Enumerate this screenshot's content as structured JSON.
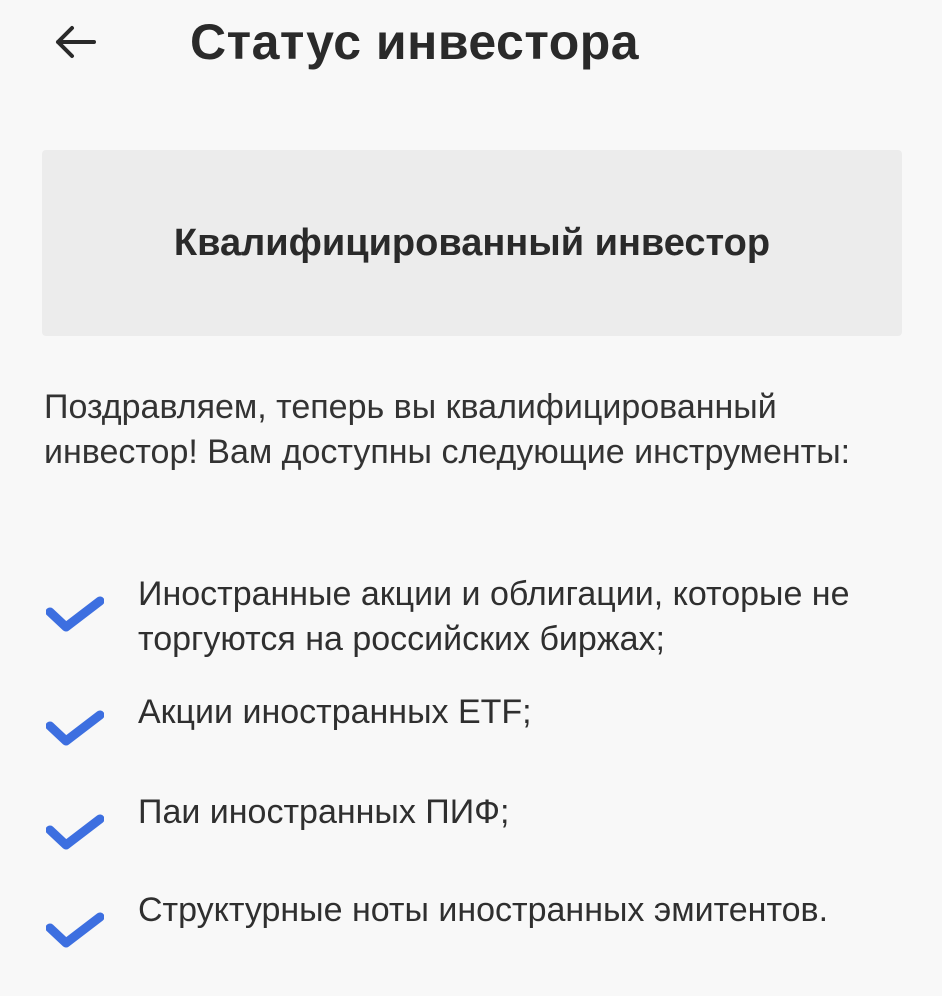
{
  "header": {
    "back_icon": "arrow-left-icon",
    "title": "Статус инвестора"
  },
  "status": {
    "label": "Квалифицированный инвестор"
  },
  "message": "Поздравляем, теперь вы квалифицированный инвестор! Вам доступны следующие инструменты:",
  "instruments": [
    {
      "icon": "checkmark-icon",
      "text": "Иностранные акции и облигации, которые не торгуются на российских биржах;"
    },
    {
      "icon": "checkmark-icon",
      "text": "Акции иностранных ETF;"
    },
    {
      "icon": "checkmark-icon",
      "text": "Паи иностранных ПИФ;"
    },
    {
      "icon": "checkmark-icon",
      "text": "Структурные ноты иностранных эмитентов."
    }
  ],
  "colors": {
    "background": "#f8f8f8",
    "card": "#ececec",
    "check": "#3d6fe0"
  }
}
